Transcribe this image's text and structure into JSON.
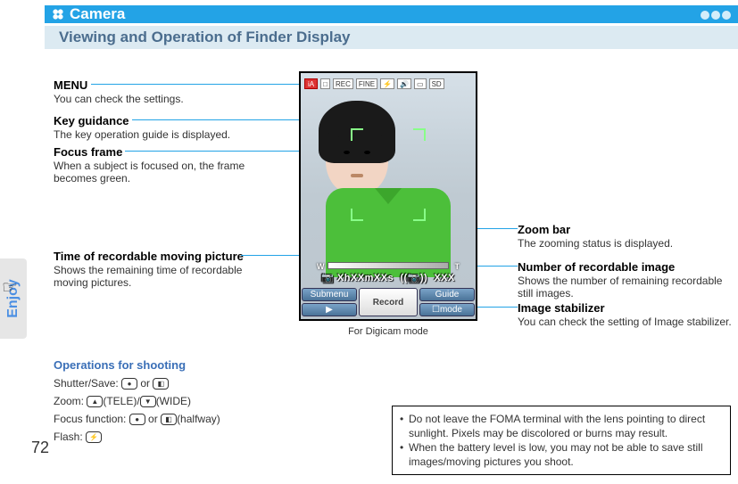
{
  "header": {
    "chapter": "Camera",
    "section_title": "Viewing and Operation of Finder Display"
  },
  "side_tab": "Enjoy",
  "page_number": "72",
  "callouts": {
    "menu": {
      "title": "MENU",
      "desc": "You can check the settings."
    },
    "key_guidance": {
      "title": "Key guidance",
      "desc": "The key operation guide is displayed."
    },
    "focus_frame": {
      "title": "Focus frame",
      "desc": "When a subject is focused on, the frame becomes green."
    },
    "time_rec": {
      "title": "Time of recordable moving picture",
      "desc": "Shows the remaining time of recordable moving pictures."
    },
    "zoom_bar": {
      "title": "Zoom bar",
      "desc": "The zooming status is displayed."
    },
    "num_rec": {
      "title": "Number of recordable image",
      "desc": "Shows the number of remaining recordable still images."
    },
    "img_stab": {
      "title": "Image stabilizer",
      "desc": "You can check the setting of Image stabilizer."
    }
  },
  "finder": {
    "top_icons": [
      "iA",
      "□",
      "REC",
      "FINE",
      "⚡",
      "🔊",
      "▭",
      "SD"
    ],
    "zoom_w": "W",
    "zoom_t": "T",
    "info_time": "XhXXmXXs",
    "info_count": "XXX",
    "btn_submenu": "Submenu",
    "btn_record": "Record",
    "btn_guide": "Guide",
    "btn_play": "▶",
    "btn_mode": "☐mode",
    "caption": "For Digicam mode"
  },
  "operations": {
    "heading": "Operations for shooting",
    "shutter": "Shutter/Save: ",
    "or": " or ",
    "zoom": "Zoom: ",
    "tele": "(TELE)/",
    "wide": "(WIDE)",
    "focus": "Focus function: ",
    "halfway": "(halfway)",
    "flash": "Flash: "
  },
  "notes": [
    "Do not leave the FOMA terminal with the lens pointing to direct sunlight. Pixels may be discolored or burns may result.",
    "When the battery level is low, you may not be able to save still images/moving pictures you shoot."
  ]
}
